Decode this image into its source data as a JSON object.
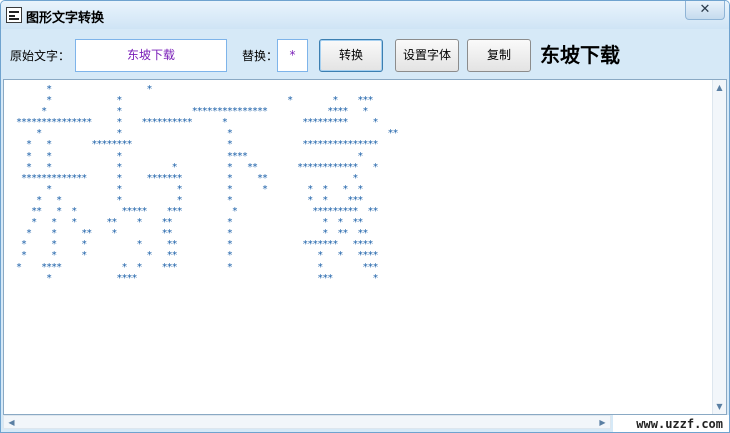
{
  "window": {
    "title": "图形文字转换",
    "close_glyph": "✕"
  },
  "toolbar": {
    "source_label": "原始文字：",
    "source_value": "东坡下载",
    "replace_label": "替换：",
    "replace_value": "*",
    "convert_label": "转换",
    "font_label": "设置字体",
    "copy_label": "复制",
    "preview_text": "东坡下载"
  },
  "output": {
    "text_color": "#1a5fa8",
    "lines": [
      "       *                   *",
      "       *             *                                 *        *    ***",
      "      *              *              ***************            ****   *",
      " ***************     *    **********      *               *********     *",
      "     *               *                     *                               **",
      "   *   *        ********                   *              ***************",
      "   *   *             *                     ****                      *",
      "   *   *             *          *          *   **        ************   *",
      "  *************      *     *******         *     **                 *",
      "       *             *           *         *      *        *  *   *  *",
      "     *   *           *           *         *               *  *    ***",
      "    **   *  *         *****    ***          *               *********  **",
      "    *   *   *      **    *    **           *                  *  *  **",
      "   *    *     **    *         **           *                  *  **  **",
      "  *     *     *          *     **          *              *******   ****",
      "  *     *     *            *   **          *                 *   *   ****",
      " *    ****            *  *    ***          *                 *        ***",
      "       *             ****                                    ***        *"
    ]
  },
  "watermark": "www.uzzf.com"
}
